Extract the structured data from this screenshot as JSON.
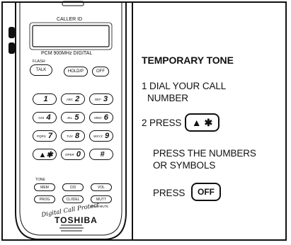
{
  "phone": {
    "display_label": "CALLER ID",
    "model_label": "PCM 900MHz DIGITAL",
    "flash_label": "FLASH",
    "buttons": {
      "talk": "TALK",
      "hold": "HOLD/P",
      "off": "OFF"
    },
    "keypad": [
      {
        "num": "1",
        "sub": ""
      },
      {
        "num": "2",
        "sub": "ABC"
      },
      {
        "num": "3",
        "sub": "DEF"
      },
      {
        "num": "4",
        "sub": "GHI"
      },
      {
        "num": "5",
        "sub": "JKL"
      },
      {
        "num": "6",
        "sub": "MNO"
      },
      {
        "num": "7",
        "sub": "PQRS"
      },
      {
        "num": "8",
        "sub": "TUV"
      },
      {
        "num": "9",
        "sub": "WXYZ"
      },
      {
        "num": "▲✱",
        "sub": ""
      },
      {
        "num": "0",
        "sub": "OPER"
      },
      {
        "num": "#",
        "sub": ""
      }
    ],
    "tone_label": "TONE",
    "function_row1": [
      "MEM",
      "CID",
      "VOL"
    ],
    "function_row2": [
      "PROG",
      "CL/IDEL",
      "MUTT"
    ],
    "ring_mute_label": "RING MUTE",
    "tagline": "Digital Call Protect",
    "brand": "TOSHIBA"
  },
  "instructions": {
    "title": "TEMPORARY TONE",
    "step1_line1": "1 DIAL YOUR CALL",
    "step1_line2": "NUMBER",
    "step2_prefix": "2 PRESS",
    "step2_key": "▲ ✱",
    "note_line1": "PRESS THE NUMBERS",
    "note_line2": "OR SYMBOLS",
    "press_label": "PRESS",
    "press_key": "OFF"
  }
}
